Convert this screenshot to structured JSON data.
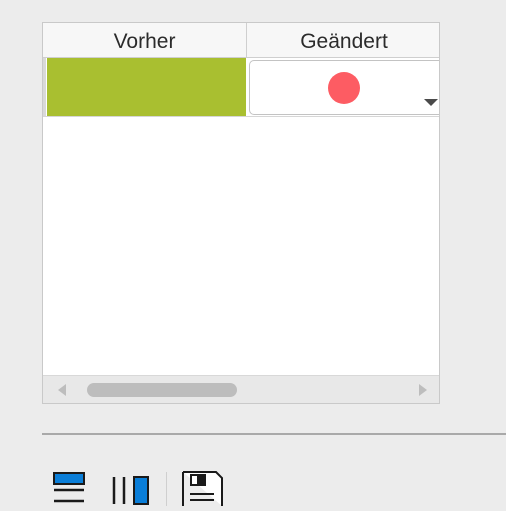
{
  "table": {
    "columns": [
      "Vorher",
      "Geändert"
    ],
    "rows": [
      {
        "before_color": "#a9bf30",
        "changed_color": "#fd5c63",
        "changed_has_dropdown": true
      }
    ]
  },
  "toolbar": {
    "buttons": [
      {
        "icon": "split-horizontal-icon"
      },
      {
        "icon": "split-vertical-icon"
      },
      {
        "icon": "save-icon"
      }
    ]
  },
  "colors": {
    "accent": "#0a7ed8",
    "background": "#ececec"
  }
}
